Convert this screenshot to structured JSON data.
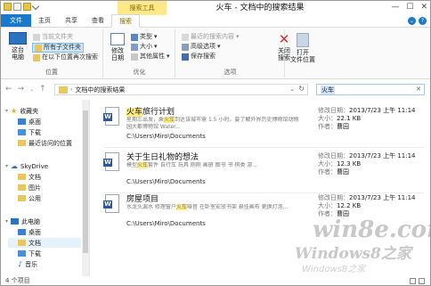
{
  "window": {
    "title": "火车 - 文档中的搜索结果",
    "context_tab": "搜索工具"
  },
  "tabs": [
    "文件",
    "主页",
    "共享",
    "查看",
    "搜索"
  ],
  "ribbon": {
    "location": {
      "this_pc_line1": "这台",
      "this_pc_line2": "电脑",
      "current_folder": "当前文件夹",
      "all_subfolders": "所有子文件夹",
      "search_again": "在以下位置再次搜索",
      "label": "位置"
    },
    "refine": {
      "modified_date_line1": "修改",
      "modified_date_line2": "日期",
      "kind": "类型",
      "size": "大小",
      "other_props": "其他属性",
      "label": "优化"
    },
    "options": {
      "recent_searches": "最近的搜索内容",
      "advanced": "高级选项",
      "save_search": "保存搜索",
      "label": "选项"
    },
    "open_location_line1": "打开",
    "open_location_line2": "文件位置",
    "close_line1": "关闭",
    "close_line2": "搜索"
  },
  "address": {
    "crumb": "文档中的搜索结果",
    "search_value": "火车"
  },
  "navpane": {
    "favorites": "收藏夹",
    "desktop": "桌面",
    "downloads": "下载",
    "recent": "最近访问的位置",
    "skydrive": "SkyDrive",
    "sky_docs": "文档",
    "sky_pics": "图片",
    "sky_public": "公用",
    "this_pc": "此电脑",
    "pc_desktop": "桌面",
    "pc_docs": "文档",
    "pc_downloads": "下载",
    "pc_music": "音乐"
  },
  "results": [
    {
      "name_hl": "火车",
      "name_rest": "旅行计划",
      "snip_a": "星期三出发，乘",
      "snip_hl": "火车",
      "snip_b": "到达该城市需 1.5 小时。要了解外界历史博物馆动物园大都博物馆 Water...",
      "path": "C:\\Users\\Miro\\Documents",
      "date_label": "修改日期：",
      "date": "2013/7/23 上午 11:14",
      "size_label": "大小：",
      "size": "22.1 KB",
      "author_label": "作者：",
      "author": "曹园"
    },
    {
      "name_hl": "",
      "name_rest": "关于生日礼物的想法",
      "snip_a": "模型",
      "snip_hl": "火车",
      "snip_b": "套件 自行车 玩具 刚刚 画册 图书 书 棋类 游...",
      "path": "C:\\Users\\Miro\\Documents",
      "date_label": "修改日期：",
      "date": "2013/7/23 上午 11:14",
      "size_label": "大小：",
      "size": "12.3 KB",
      "author_label": "作者：",
      "author": "曹园"
    },
    {
      "name_hl": "",
      "name_rest": "房屋项目",
      "snip_a": "水龙头漏水 修理窗户",
      "snip_hl": "火车",
      "snip_b": "噪音 在卧室安放书架 悬挂画布 更换灯泡...",
      "path": "C:\\Users\\Miro\\Documents",
      "date_label": "修改日期：",
      "date": "2013/7/23 上午 11:14",
      "size_label": "大小：",
      "size": "12.2 KB",
      "author_label": "作者：",
      "author": "曹园"
    }
  ],
  "status": "4 个项目",
  "watermark": {
    "line1": "win8e.com",
    "line2": "Windows8之家",
    "line3": "Windows8之家"
  },
  "colors": {
    "accent": "#1979ca",
    "context_tab": "#ffe88a",
    "highlight": "#ffec80"
  }
}
